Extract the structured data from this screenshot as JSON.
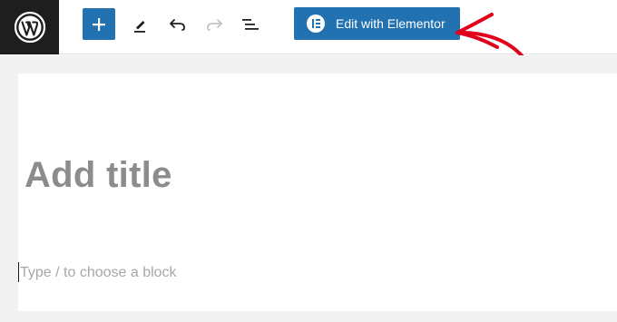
{
  "header": {
    "logo_icon": "wordpress-logo-icon",
    "toolbar": {
      "add_block_icon": "plus-icon",
      "tools_icon": "pencil-icon",
      "undo_icon": "undo-icon",
      "redo_icon": "redo-icon",
      "list_view_icon": "list-view-icon"
    },
    "elementor_button": {
      "label": "Edit with Elementor",
      "icon": "elementor-icon"
    }
  },
  "editor": {
    "title_placeholder": "Add title",
    "block_placeholder": "Type / to choose a block"
  },
  "annotation": {
    "icon": "red-arrow-icon",
    "color": "#e0001b"
  },
  "colors": {
    "accent": "#2271b1",
    "logo_bg": "#1e1e1e",
    "canvas_bg": "#f1f1f1"
  }
}
